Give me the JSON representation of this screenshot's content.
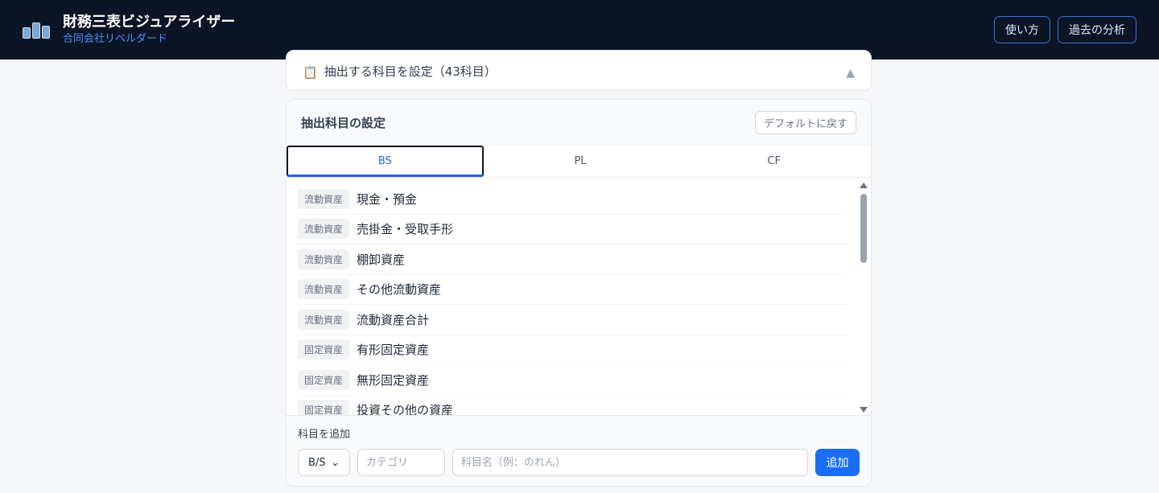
{
  "header": {
    "title": "財務三表ビジュアライザー",
    "subtitle": "合同会社リベルダード",
    "help_label": "使い方",
    "history_label": "過去の分析"
  },
  "collapsed_section": {
    "icon": "clipboard-icon",
    "label": "抽出する科目を設定（43科目）",
    "toggle": "▲"
  },
  "settings": {
    "title": "抽出科目の設定",
    "reset_label": "デフォルトに戻す",
    "tabs": [
      {
        "label": "BS",
        "active": true
      },
      {
        "label": "PL",
        "active": false
      },
      {
        "label": "CF",
        "active": false
      }
    ],
    "items": [
      {
        "category": "流動資産",
        "name": "現金・預金"
      },
      {
        "category": "流動資産",
        "name": "売掛金・受取手形"
      },
      {
        "category": "流動資産",
        "name": "棚卸資産"
      },
      {
        "category": "流動資産",
        "name": "その他流動資産"
      },
      {
        "category": "流動資産",
        "name": "流動資産合計"
      },
      {
        "category": "固定資産",
        "name": "有形固定資産"
      },
      {
        "category": "固定資産",
        "name": "無形固定資産"
      },
      {
        "category": "固定資産",
        "name": "投資その他の資産"
      }
    ]
  },
  "add": {
    "label": "科目を追加",
    "statement_value": "B/S",
    "category_placeholder": "カテゴリ",
    "name_placeholder": "科目名（例：のれん）",
    "add_label": "追加"
  },
  "colors": {
    "header_bg": "#0b1526",
    "accent": "#1a6ef5",
    "subtitle": "#4f8ff7"
  }
}
